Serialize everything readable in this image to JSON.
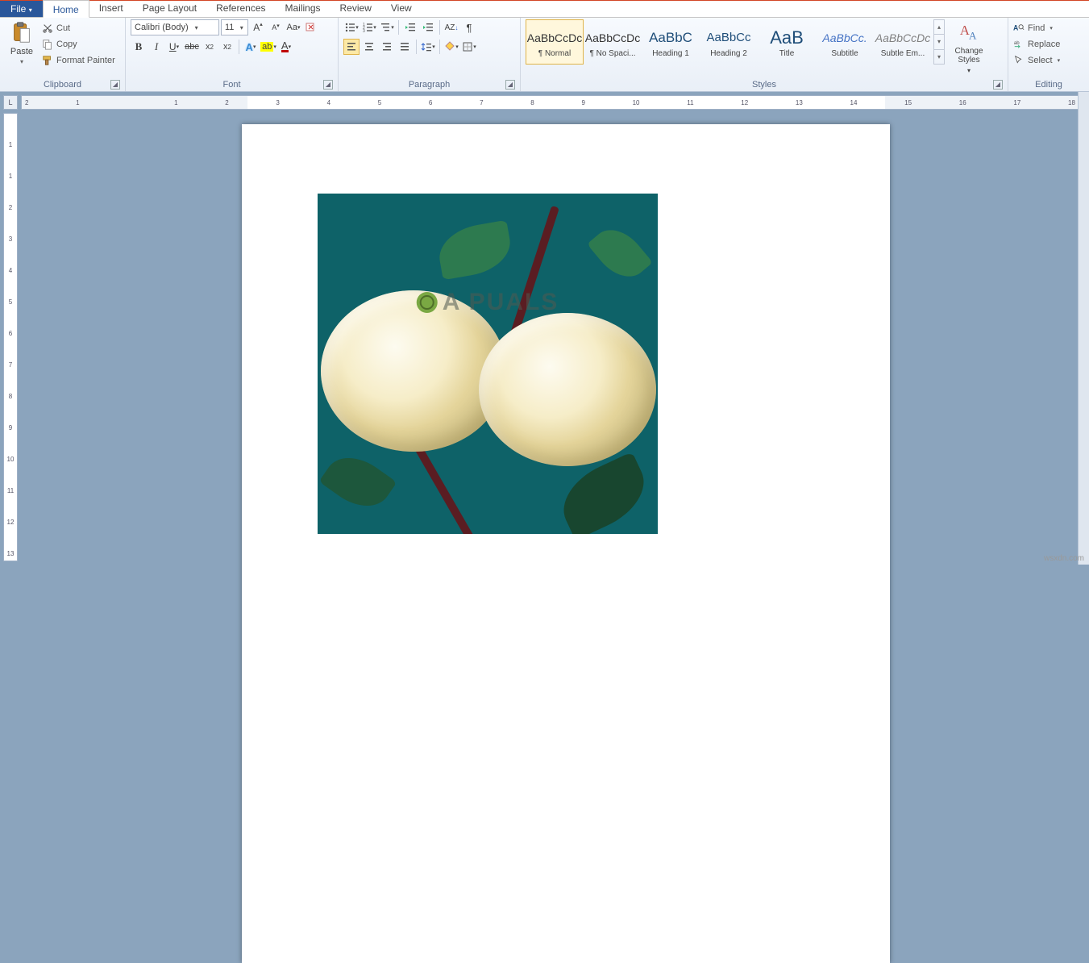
{
  "tabs": {
    "file": "File",
    "home": "Home",
    "insert": "Insert",
    "page_layout": "Page Layout",
    "references": "References",
    "mailings": "Mailings",
    "review": "Review",
    "view": "View"
  },
  "clipboard": {
    "paste": "Paste",
    "cut": "Cut",
    "copy": "Copy",
    "format_painter": "Format Painter",
    "label": "Clipboard"
  },
  "font": {
    "name": "Calibri (Body)",
    "size": "11",
    "label": "Font"
  },
  "paragraph": {
    "label": "Paragraph"
  },
  "styles": {
    "label": "Styles",
    "change": "Change Styles",
    "items": [
      {
        "sample": "AaBbCcDc",
        "name": "¶ Normal",
        "cls": ""
      },
      {
        "sample": "AaBbCcDc",
        "name": "¶ No Spaci...",
        "cls": ""
      },
      {
        "sample": "AaBbC",
        "name": "Heading 1",
        "cls": "blue"
      },
      {
        "sample": "AaBbCc",
        "name": "Heading 2",
        "cls": "blue"
      },
      {
        "sample": "AaB",
        "name": "Title",
        "cls": "bigblue"
      },
      {
        "sample": "AaBbCc.",
        "name": "Subtitle",
        "cls": "ital"
      },
      {
        "sample": "AaBbCcDc",
        "name": "Subtle Em...",
        "cls": "gray"
      }
    ]
  },
  "editing": {
    "find": "Find",
    "replace": "Replace",
    "select": "Select",
    "label": "Editing"
  },
  "ruler": {
    "h": [
      "2",
      "1",
      "",
      "1",
      "2",
      "3",
      "4",
      "5",
      "6",
      "7",
      "8",
      "9",
      "10",
      "11",
      "12",
      "13",
      "14",
      "15",
      "16",
      "17",
      "18"
    ],
    "v": [
      "",
      "1",
      "1",
      "2",
      "3",
      "4",
      "5",
      "6",
      "7",
      "8",
      "9",
      "10",
      "11",
      "12",
      "13"
    ]
  },
  "watermark": "A   PUALS",
  "site": "wsxdn.com"
}
